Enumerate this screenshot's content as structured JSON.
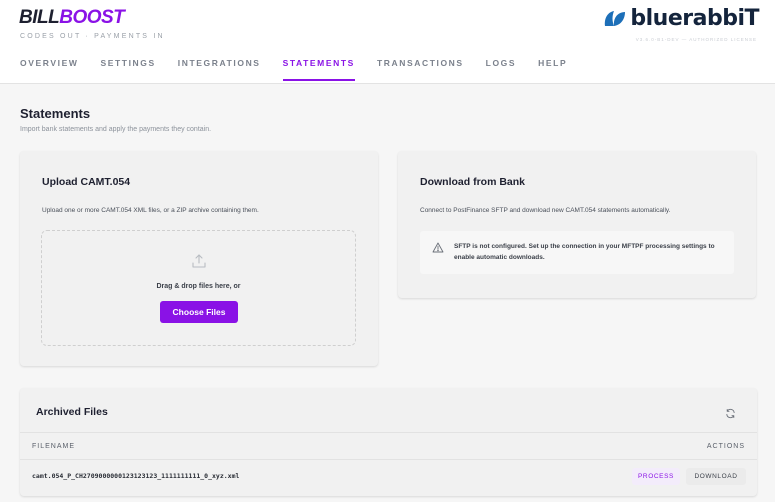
{
  "header": {
    "brand_part1": "BILL",
    "brand_part2": "BOOST",
    "tagline": "CODES OUT · PAYMENTS IN",
    "logo_text": "bluerabbiT",
    "version": "V3.6.0-B1-DEV — AUTHORIZED LICENSE"
  },
  "nav": {
    "tabs": [
      "OVERVIEW",
      "SETTINGS",
      "INTEGRATIONS",
      "STATEMENTS",
      "TRANSACTIONS",
      "LOGS",
      "HELP"
    ],
    "active": "STATEMENTS"
  },
  "page": {
    "title": "Statements",
    "subtitle": "Import bank statements and apply the payments they contain."
  },
  "upload_card": {
    "title": "Upload CAMT.054",
    "description": "Upload one or more CAMT.054 XML files, or a ZIP archive containing them.",
    "drop_text": "Drag & drop files here, or",
    "choose_button": "Choose Files"
  },
  "bank_card": {
    "title": "Download from Bank",
    "description": "Connect to PostFinance SFTP and download new CAMT.054 statements automatically.",
    "notice": "SFTP is not configured. Set up the connection in your MFTPF processing settings to enable automatic downloads."
  },
  "archive": {
    "title": "Archived Files",
    "columns": {
      "filename": "FILENAME",
      "actions": "ACTIONS"
    },
    "rows": [
      {
        "filename": "camt.054_P_CH2709000000123123123_1111111111_0_xyz.xml",
        "process_label": "PROCESS",
        "download_label": "DOWNLOAD"
      }
    ]
  },
  "colors": {
    "accent": "#8a12e6",
    "logo": "#14243c",
    "card_bg": "#f1f1f1",
    "page_bg": "#f6f6f6"
  },
  "icons": {
    "logo": "rabbit-logo-icon",
    "upload": "upload-icon",
    "warning": "warning-icon",
    "refresh": "refresh-icon"
  }
}
